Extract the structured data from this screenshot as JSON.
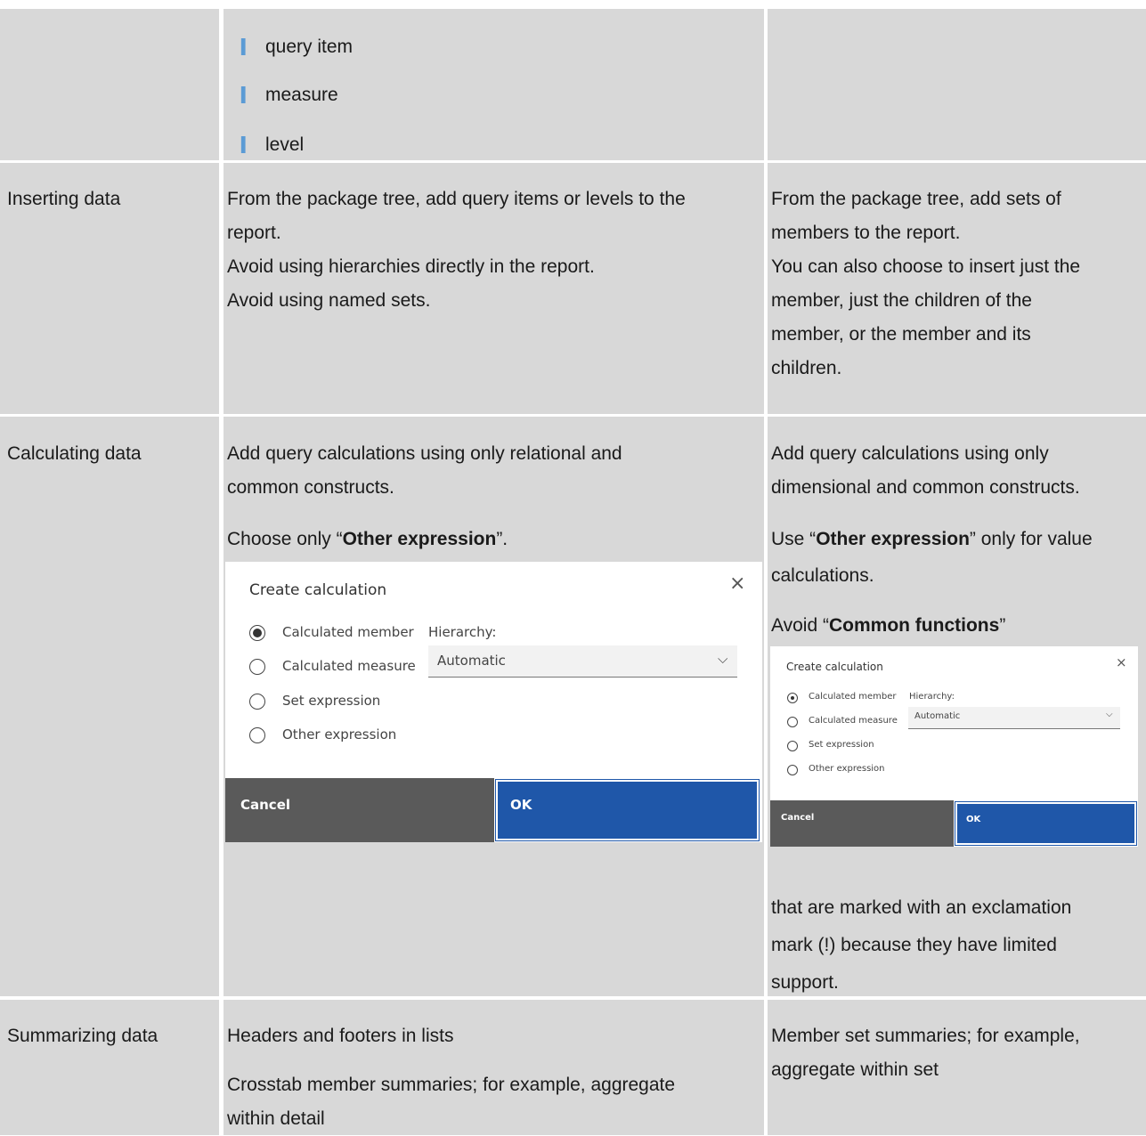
{
  "row0": {
    "bullets": [
      "query item",
      "measure",
      "level"
    ]
  },
  "row1": {
    "label": "Inserting data",
    "rel": [
      "From the package tree, add query items or levels to the",
      "report.",
      "Avoid using hierarchies directly in the report.",
      "Avoid using named sets."
    ],
    "dim": [
      "From the package tree, add sets of",
      "members to the report.",
      "You can also choose to insert just the",
      "member, just the children of the",
      "member, or the member and its",
      "children."
    ]
  },
  "row2": {
    "label": "Calculating data",
    "rel_line1": "Add query calculations using only relational and",
    "rel_line2": "common constructs.",
    "rel_choose_pre": "Choose only “",
    "rel_choose_bold": "Other expression",
    "rel_choose_post": "”.",
    "dim_line1": "Add query calculations using only",
    "dim_line2": "dimensional and common constructs.",
    "dim_use_pre": "Use “",
    "dim_use_bold": "Other expression",
    "dim_use_post": "” only for value",
    "dim_line4": "calculations.",
    "dim_avoid_pre": "Avoid “",
    "dim_avoid_bold": "Common functions",
    "dim_avoid_post": "”",
    "dim_tail": [
      "that are marked with an exclamation",
      "mark (!) because they have limited",
      "support."
    ],
    "dialog": {
      "title": "Create calculation",
      "close": "×",
      "options": [
        "Calculated member",
        "Calculated measure",
        "Set expression",
        "Other expression"
      ],
      "selected_index": 0,
      "hierarchy_label": "Hierarchy:",
      "hierarchy_value": "Automatic",
      "cancel": "Cancel",
      "ok": "OK"
    }
  },
  "row3": {
    "label": "Summarizing data",
    "rel": [
      "Headers and footers in lists",
      "Crosstab member summaries; for example, aggregate",
      "within detail"
    ],
    "dim": [
      "Member set summaries; for example,",
      "aggregate within set"
    ]
  }
}
